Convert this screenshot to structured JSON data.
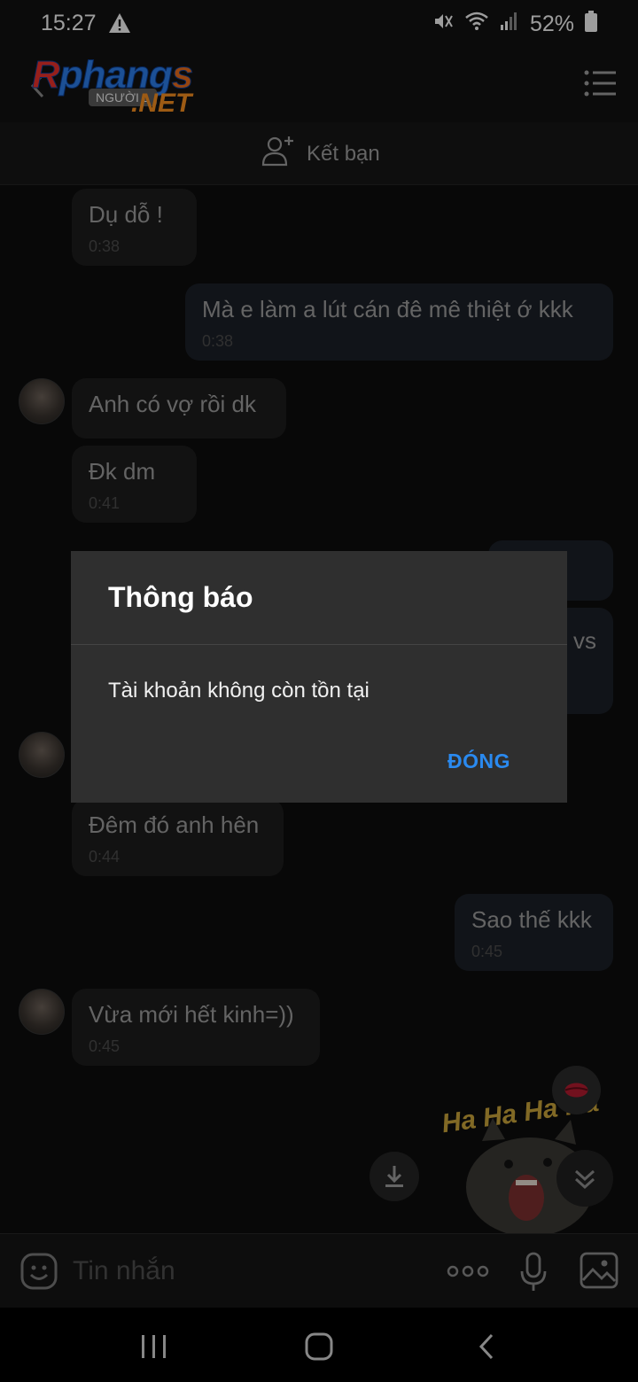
{
  "status_bar": {
    "time": "15:27",
    "battery": "52%"
  },
  "header": {
    "logo_text": "Rphangs",
    "logo_tag": "NGƯỜI L",
    "logo_domain": ".NET",
    "friend_label": "Kết bạn"
  },
  "messages": [
    {
      "side": "in",
      "text": "Dụ dỗ !",
      "time": "0:38"
    },
    {
      "side": "out",
      "text": "Mà e làm a lút cán đê mê thiệt ớ kkk",
      "time": "0:38"
    },
    {
      "side": "in",
      "text": "Anh có vợ rồi dk",
      "time": ""
    },
    {
      "side": "in",
      "text": "Đk dm",
      "time": "0:41"
    },
    {
      "side": "out",
      "text": "vs",
      "time": ""
    },
    {
      "side": "in",
      "text": "Đêm đó anh hên",
      "time": "0:44"
    },
    {
      "side": "out",
      "text": "Sao thế kkk",
      "time": "0:45"
    },
    {
      "side": "in",
      "text": "Vừa mới hết kinh=))",
      "time": "0:45"
    }
  ],
  "sticker": {
    "text": "Ha Ha Ha Ha"
  },
  "dialog": {
    "title": "Thông báo",
    "body": "Tài khoản không còn tồn tại",
    "button": "ĐÓNG"
  },
  "input": {
    "placeholder": "Tin nhắn"
  },
  "icons": {
    "back": "chevron-left-icon",
    "menu": "list-menu-icon",
    "add_friend": "add-person-icon",
    "emoji": "emoji-icon",
    "more": "more-dots-icon",
    "mic": "microphone-icon",
    "gallery": "image-icon",
    "download": "download-icon",
    "scroll_down": "double-chevron-down-icon",
    "lips": "lips-icon"
  },
  "colors": {
    "accent": "#2a8af0",
    "background": "#0d0d0d",
    "dialog": "#2f2f2f"
  }
}
